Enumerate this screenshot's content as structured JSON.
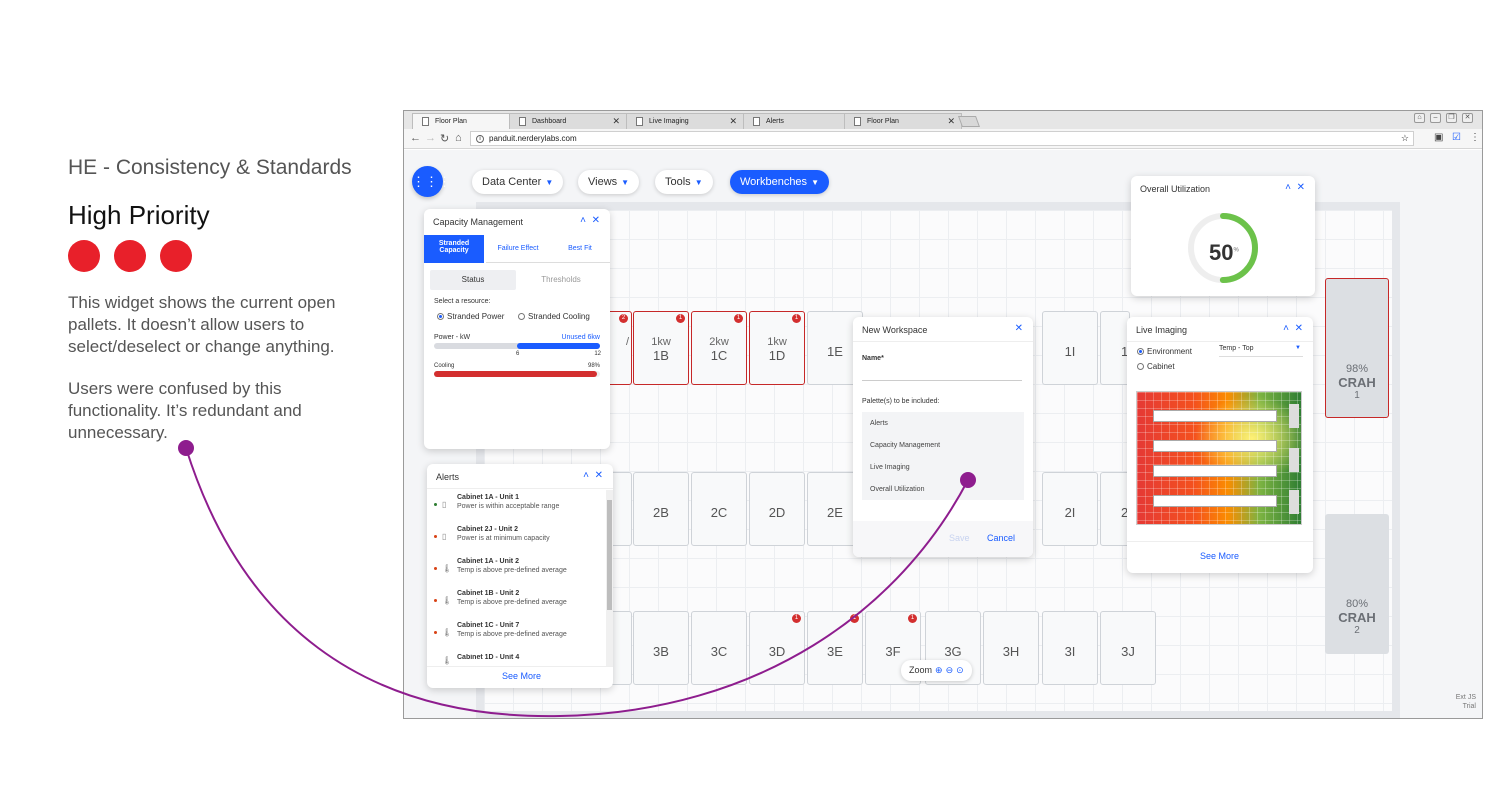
{
  "annotation": {
    "title": "HE - Consistency & Standards",
    "priority": "High Priority",
    "para1": "This widget shows the current open pallets. It doesn’t allow users to select/deselect or change anything.",
    "para2": "Users were confused by this functionality. It’s redundant and unnecessary."
  },
  "browser": {
    "tabs": [
      {
        "label": "Floor Plan",
        "active": true
      },
      {
        "label": "Dashboard",
        "active": false
      },
      {
        "label": "Live Imaging",
        "active": false
      },
      {
        "label": "Alerts",
        "active": false
      },
      {
        "label": "Floor Plan",
        "active": false
      }
    ],
    "url": "panduit.nerderylabs.com"
  },
  "nav": {
    "data_center": "Data Center",
    "views": "Views",
    "tools": "Tools",
    "workbenches": "Workbenches"
  },
  "cabinets": {
    "row1": [
      {
        "kw": "1kw",
        "name": "1B",
        "badge": "1"
      },
      {
        "kw": "2kw",
        "name": "1C",
        "badge": "1"
      },
      {
        "kw": "1kw",
        "name": "1D",
        "badge": "1"
      },
      {
        "kw": "",
        "name": "1E",
        "badge": ""
      },
      {
        "kw": "",
        "name": "1I",
        "badge": ""
      }
    ],
    "row1_partial_badge": "2",
    "row1_partial_text": "/",
    "row2": [
      "2B",
      "2C",
      "2D",
      "2E",
      "2I"
    ],
    "row3": [
      {
        "name": "3B",
        "badge": ""
      },
      {
        "name": "3C",
        "badge": ""
      },
      {
        "name": "3D",
        "badge": "1"
      },
      {
        "name": "3E",
        "badge": "1"
      },
      {
        "name": "3F",
        "badge": "1"
      },
      {
        "name": "3G",
        "badge": ""
      },
      {
        "name": "3H",
        "badge": ""
      },
      {
        "name": "3I",
        "badge": ""
      },
      {
        "name": "3J",
        "badge": ""
      }
    ],
    "edge_1": "1",
    "edge_2": "2"
  },
  "crah": [
    {
      "pct": "98%",
      "label": "CRAH",
      "num": "1"
    },
    {
      "pct": "80%",
      "label": "CRAH",
      "num": "2"
    }
  ],
  "capacity": {
    "title": "Capacity Management",
    "tabs": [
      "Stranded Capacity",
      "Failure Effect",
      "Best Fit"
    ],
    "subtabs": [
      "Status",
      "Thresholds"
    ],
    "select_label": "Select a resource:",
    "options": [
      "Stranded Power",
      "Stranded Cooling"
    ],
    "power_label": "Power - kW",
    "unused_label": "Unused 6kw",
    "tick_mid": "6",
    "tick_max": "12",
    "power_fill": 0.5,
    "cooling_label": "Cooling",
    "cooling_pct": "98%",
    "cooling_fill": 0.98
  },
  "alerts": {
    "title": "Alerts",
    "items": [
      {
        "title": "Cabinet 1A - Unit 1",
        "sub": "Power is within acceptable range",
        "icon": "battery-icon",
        "color": "#2e7d32"
      },
      {
        "title": "Cabinet 2J - Unit 2",
        "sub": "Power is at minimum capacity",
        "icon": "battery-icon",
        "color": "#d84315"
      },
      {
        "title": "Cabinet 1A - Unit 2",
        "sub": "Temp is above pre-defined average",
        "icon": "thermometer-icon",
        "color": "#d84315"
      },
      {
        "title": "Cabinet 1B - Unit 2",
        "sub": "Temp is above pre-defined average",
        "icon": "thermometer-icon",
        "color": "#d84315"
      },
      {
        "title": "Cabinet 1C - Unit 7",
        "sub": "Temp is above pre-defined average",
        "icon": "thermometer-icon",
        "color": "#d84315"
      },
      {
        "title": "Cabinet 1D - Unit 4",
        "sub": "",
        "icon": "thermometer-icon",
        "color": "#d84315"
      }
    ],
    "see_more": "See More"
  },
  "workspace": {
    "title": "New Workspace",
    "name_label": "Name*",
    "palettes_label": "Palette(s) to be included:",
    "palettes": [
      "Alerts",
      "Capacity Management",
      "Live Imaging",
      "Overall Utilization"
    ],
    "save": "Save",
    "cancel": "Cancel"
  },
  "utilization": {
    "title": "Overall Utilization",
    "value": "50",
    "unit": "%",
    "fraction": 0.5
  },
  "imaging": {
    "title": "Live Imaging",
    "options": [
      "Environment",
      "Cabinet"
    ],
    "select_value": "Temp - Top",
    "see_more": "See More"
  },
  "zoom": {
    "label": "Zoom"
  },
  "ext": {
    "line1": "Ext JS",
    "line2": "Trial"
  },
  "colors": {
    "accent": "#1a5cff",
    "alert_red": "#c62828",
    "priority_red": "#e8202a",
    "annotation_line": "#8e1d8e"
  }
}
